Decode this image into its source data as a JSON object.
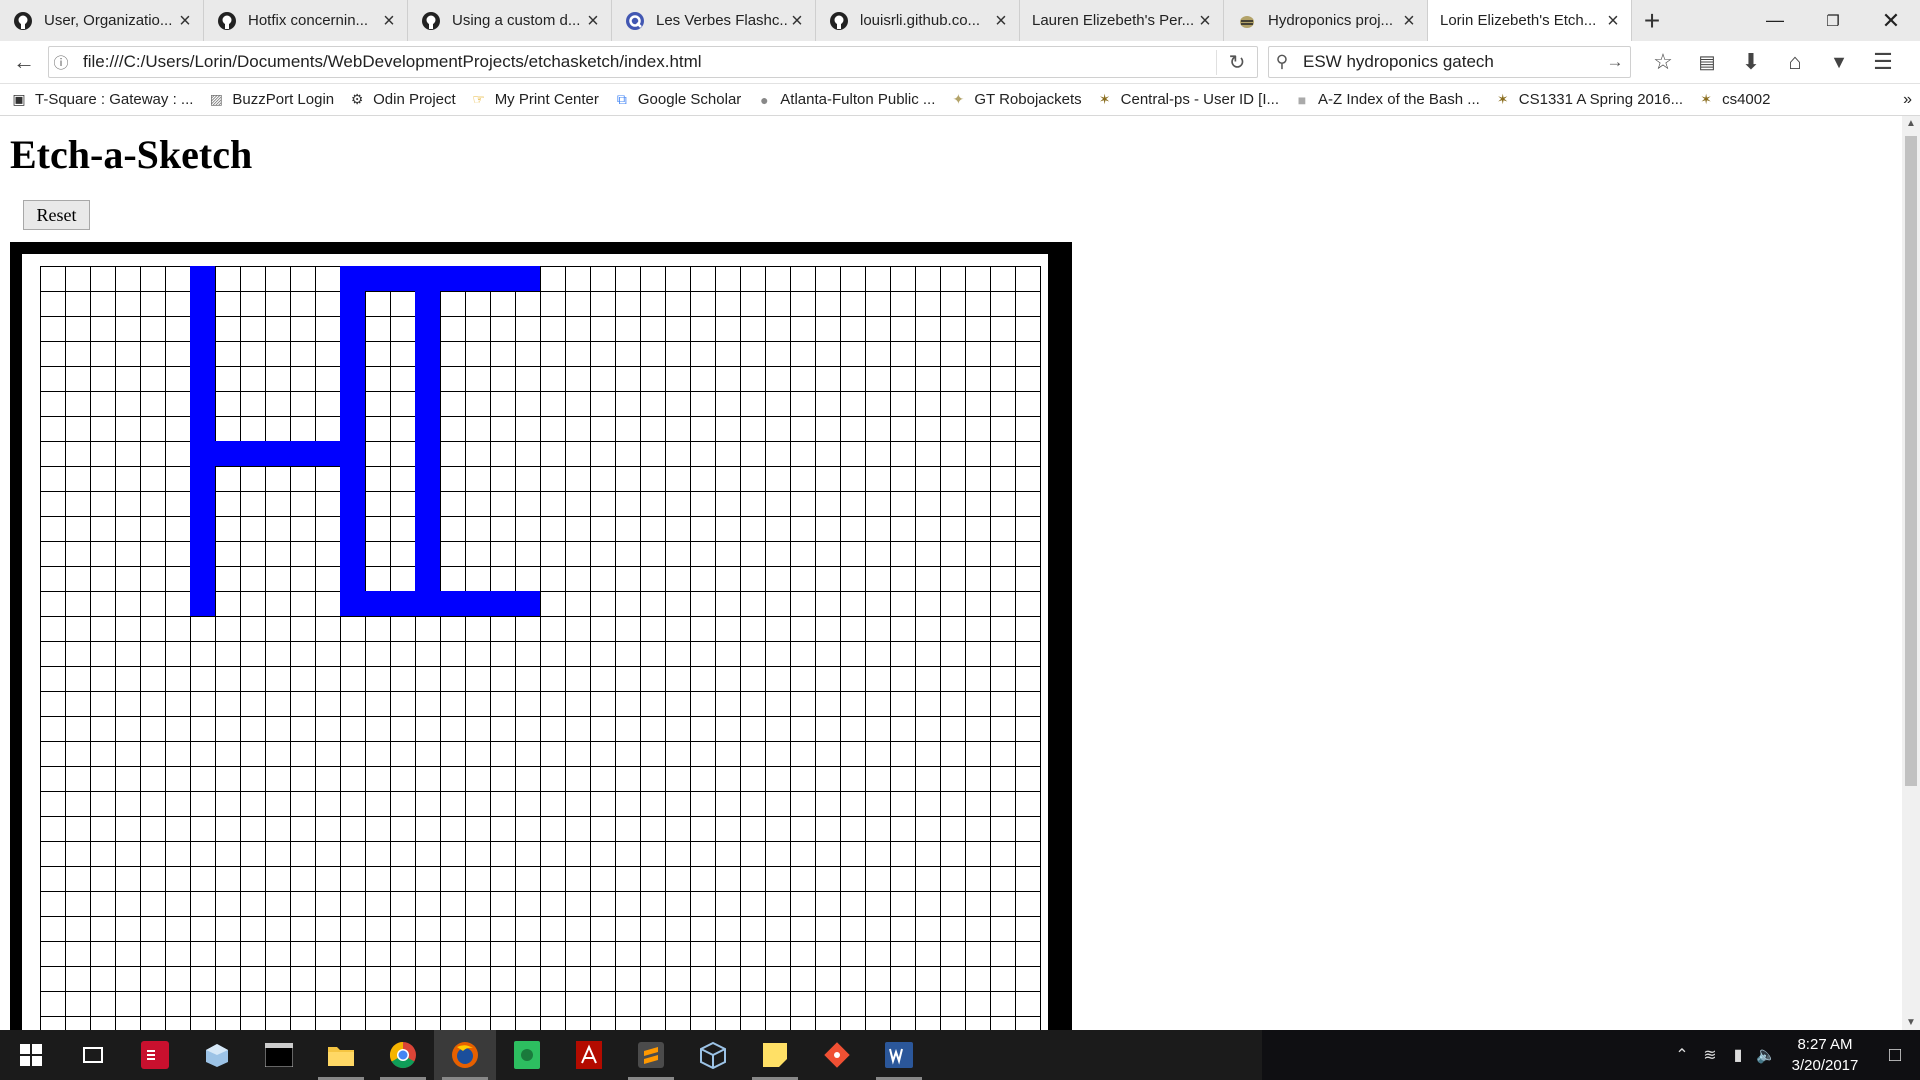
{
  "browser": {
    "tabs": [
      {
        "label": "User, Organizatio...",
        "icon": "github-icon"
      },
      {
        "label": "Hotfix concernin...",
        "icon": "github-icon"
      },
      {
        "label": "Using a custom d...",
        "icon": "github-icon"
      },
      {
        "label": "Les Verbes Flashc...",
        "icon": "quizlet-icon"
      },
      {
        "label": "louisrli.github.co...",
        "icon": "github-icon"
      },
      {
        "label": "Lauren Elizebeth's Per...",
        "icon": "none"
      },
      {
        "label": "Hydroponics proj...",
        "icon": "buzz-icon"
      },
      {
        "label": "Lorin Elizebeth's Etch...",
        "icon": "none",
        "active": true
      }
    ],
    "address": "file:///C:/Users/Lorin/Documents/WebDevelopmentProjects/etchasketch/index.html",
    "search_value": "ESW hydroponics gatech",
    "bookmarks": [
      {
        "label": "T-Square : Gateway : ..."
      },
      {
        "label": "BuzzPort Login"
      },
      {
        "label": "Odin Project"
      },
      {
        "label": "My Print Center"
      },
      {
        "label": "Google Scholar"
      },
      {
        "label": "Atlanta-Fulton Public ..."
      },
      {
        "label": "GT Robojackets"
      },
      {
        "label": "Central-ps - User ID [I..."
      },
      {
        "label": "A-Z Index of the Bash ..."
      },
      {
        "label": "CS1331 A Spring 2016..."
      },
      {
        "label": "cs4002"
      }
    ]
  },
  "page": {
    "title": "Etch-a-Sketch",
    "reset_label": "Reset",
    "grid": {
      "columns": 40,
      "visible_rows": 31,
      "fill_color": "#0000ff",
      "filled_cells": [
        [
          0,
          6
        ],
        [
          1,
          6
        ],
        [
          2,
          6
        ],
        [
          3,
          6
        ],
        [
          4,
          6
        ],
        [
          5,
          6
        ],
        [
          6,
          6
        ],
        [
          7,
          6
        ],
        [
          8,
          6
        ],
        [
          9,
          6
        ],
        [
          10,
          6
        ],
        [
          11,
          6
        ],
        [
          12,
          6
        ],
        [
          13,
          6
        ],
        [
          7,
          7
        ],
        [
          7,
          8
        ],
        [
          7,
          9
        ],
        [
          7,
          10
        ],
        [
          7,
          11
        ],
        [
          0,
          12
        ],
        [
          1,
          12
        ],
        [
          2,
          12
        ],
        [
          3,
          12
        ],
        [
          4,
          12
        ],
        [
          5,
          12
        ],
        [
          6,
          12
        ],
        [
          7,
          12
        ],
        [
          8,
          12
        ],
        [
          9,
          12
        ],
        [
          10,
          12
        ],
        [
          11,
          12
        ],
        [
          12,
          12
        ],
        [
          13,
          12
        ],
        [
          0,
          13
        ],
        [
          0,
          14
        ],
        [
          0,
          15
        ],
        [
          0,
          16
        ],
        [
          0,
          17
        ],
        [
          0,
          18
        ],
        [
          0,
          19
        ],
        [
          1,
          15
        ],
        [
          2,
          15
        ],
        [
          3,
          15
        ],
        [
          4,
          15
        ],
        [
          5,
          15
        ],
        [
          6,
          15
        ],
        [
          7,
          15
        ],
        [
          8,
          15
        ],
        [
          9,
          15
        ],
        [
          10,
          15
        ],
        [
          11,
          15
        ],
        [
          12,
          15
        ],
        [
          13,
          15
        ],
        [
          13,
          13
        ],
        [
          13,
          14
        ],
        [
          13,
          16
        ],
        [
          13,
          17
        ],
        [
          13,
          18
        ],
        [
          13,
          19
        ]
      ]
    }
  },
  "taskbar": {
    "time": "8:27 AM",
    "date": "3/20/2017"
  }
}
